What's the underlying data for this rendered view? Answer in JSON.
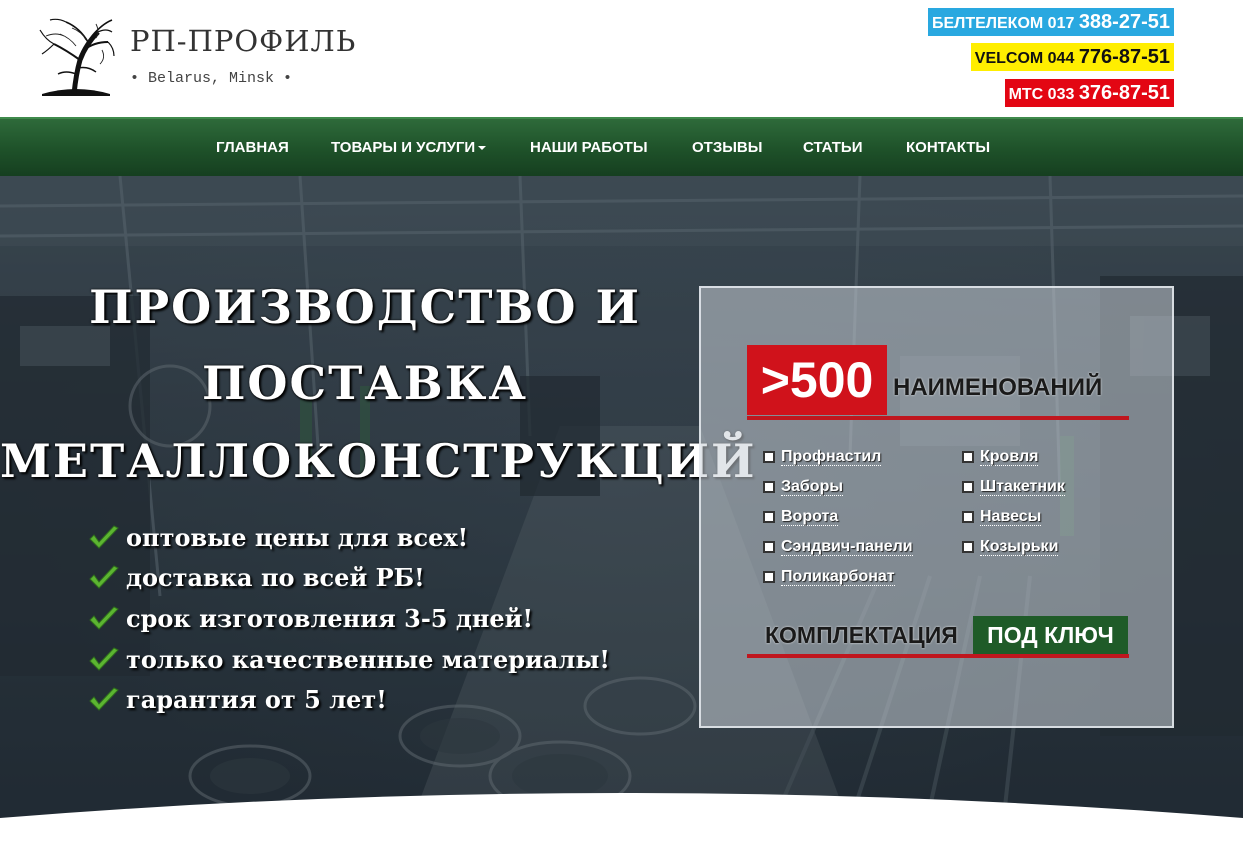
{
  "logo": {
    "name": "РП-ПРОФИЛЬ",
    "subtitle": "• Belarus, Minsk •"
  },
  "phones": [
    {
      "operator": "БЕЛТЕЛЕКОМ 017",
      "number": "388-27-51",
      "color": "#29a8e0"
    },
    {
      "operator": "VELCOM 044",
      "number": "776-87-51",
      "color": "#ffee00"
    },
    {
      "operator": "МТС 033",
      "number": "376-87-51",
      "color": "#e30613"
    }
  ],
  "nav": {
    "items": [
      {
        "label": "ГЛАВНАЯ"
      },
      {
        "label": "ТОВАРЫ И УСЛУГИ",
        "dropdown": true
      },
      {
        "label": "НАШИ РАБОТЫ"
      },
      {
        "label": "ОТЗЫВЫ"
      },
      {
        "label": "СТАТЬИ"
      },
      {
        "label": "КОНТАКТЫ"
      }
    ]
  },
  "hero": {
    "headline": [
      "ПРОИЗВОДСТВО И",
      "ПОСТАВКА",
      "МЕТАЛЛОКОНСТРУКЦИЙ"
    ],
    "features": [
      "оптовые цены для всех!",
      "доставка по всей РБ!",
      "срок изготовления 3-5 дней!",
      "только качественные материалы!",
      "гарантия от 5 лет!"
    ]
  },
  "panel": {
    "badge": ">500",
    "badge_word": "НАИМЕНОВАНИЙ",
    "products_left": [
      "Профнастил",
      "Заборы",
      "Ворота",
      "Сэндвич-панели",
      "Поликарбонат"
    ],
    "products_right": [
      "Кровля",
      "Штакетник",
      "Навесы",
      "Козырьки"
    ],
    "komplektaciya": "КОМПЛЕКТАЦИЯ",
    "pod_klyuch": "ПОД КЛЮЧ"
  },
  "colors": {
    "nav_green": "#1e5129",
    "accent_red": "#d0121b",
    "check_green": "#5cb531"
  }
}
